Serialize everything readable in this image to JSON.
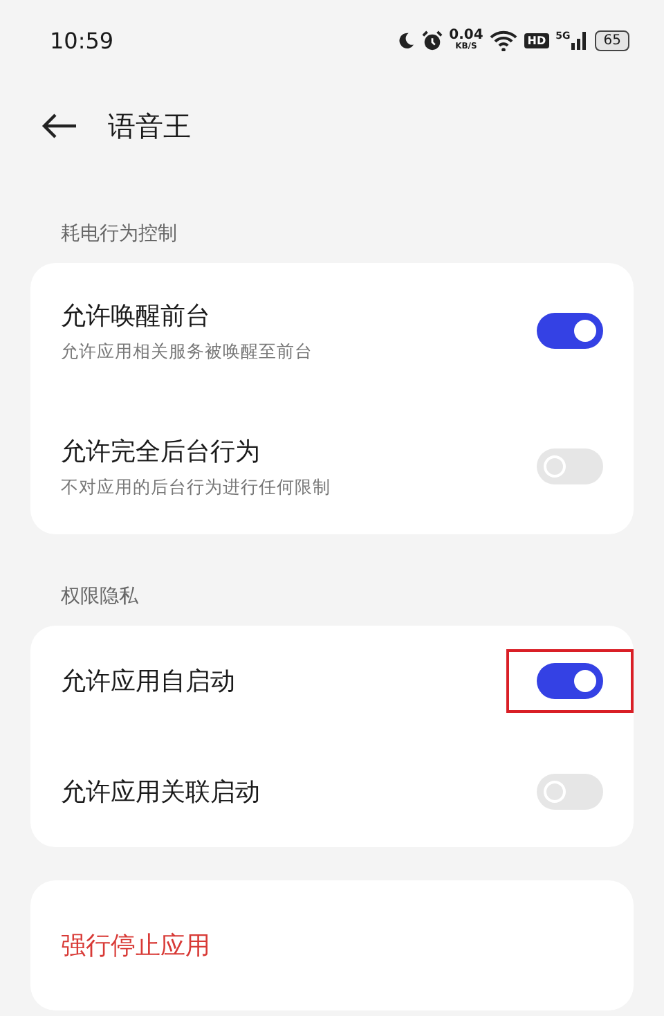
{
  "status_bar": {
    "time": "10:59",
    "speed_value": "0.04",
    "speed_unit": "KB/S",
    "hd_label": "HD",
    "network_label": "5G",
    "battery": "65"
  },
  "header": {
    "title": "语音王"
  },
  "sections": [
    {
      "label": "耗电行为控制",
      "items": [
        {
          "title": "允许唤醒前台",
          "subtitle": "允许应用相关服务被唤醒至前台",
          "on": true,
          "highlighted": false
        },
        {
          "title": "允许完全后台行为",
          "subtitle": "不对应用的后台行为进行任何限制",
          "on": false,
          "highlighted": false
        }
      ]
    },
    {
      "label": "权限隐私",
      "items": [
        {
          "title": "允许应用自启动",
          "on": true,
          "highlighted": true
        },
        {
          "title": "允许应用关联启动",
          "on": false,
          "highlighted": false
        }
      ]
    }
  ],
  "action": {
    "label": "强行停止应用"
  }
}
